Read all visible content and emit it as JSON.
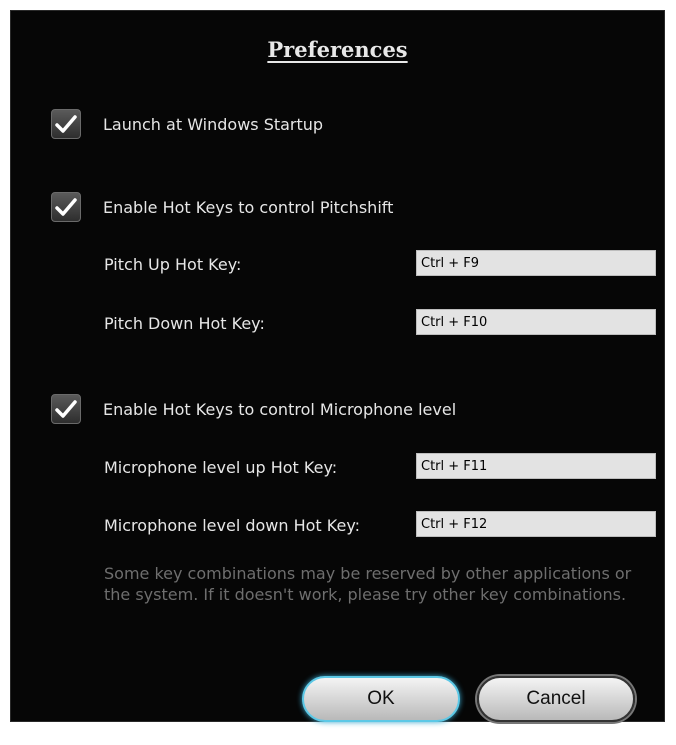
{
  "dialog": {
    "title": "Preferences"
  },
  "options": {
    "launch_startup": {
      "label": "Launch at Windows Startup",
      "checked": true
    },
    "pitch_hotkeys": {
      "label": "Enable Hot Keys to control Pitchshift",
      "checked": true
    },
    "mic_hotkeys": {
      "label": "Enable Hot Keys to control Microphone level",
      "checked": true
    }
  },
  "hotkeys": {
    "pitch_up": {
      "label": "Pitch Up Hot Key:",
      "value": "Ctrl + F9"
    },
    "pitch_down": {
      "label": "Pitch Down Hot Key:",
      "value": "Ctrl + F10"
    },
    "mic_up": {
      "label": "Microphone level up Hot Key:",
      "value": "Ctrl + F11"
    },
    "mic_down": {
      "label": "Microphone level down Hot Key:",
      "value": "Ctrl + F12"
    }
  },
  "note": "Some key combinations may be reserved by other applications or the system. If it doesn't work, please try other key combinations.",
  "buttons": {
    "ok": "OK",
    "cancel": "Cancel"
  },
  "colors": {
    "background": "#060606",
    "ok_focus_glow": "#5cc8e6"
  }
}
